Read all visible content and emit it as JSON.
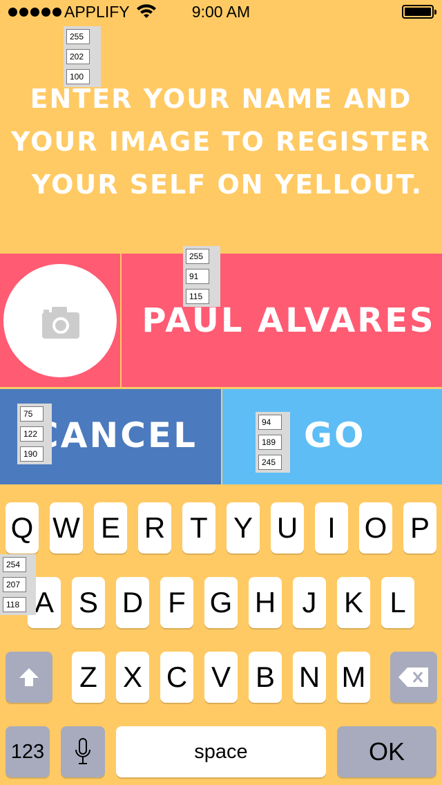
{
  "status_bar": {
    "carrier": "APPLIFY",
    "time": "9:00 AM"
  },
  "headline": {
    "line1": "ENTER YOUR NAME AND",
    "line2": "YOUR IMAGE TO REGISTER",
    "line3": "YOUR SELF ON YELLOUT."
  },
  "registration": {
    "name_value": "PAUL ALVARES"
  },
  "actions": {
    "cancel_label": "CANCEL",
    "go_label": "GO"
  },
  "swatches": {
    "background": {
      "r": "255",
      "g": "202",
      "b": "100",
      "hex": "#ffca64"
    },
    "name_panel": {
      "r": "255",
      "g": "91",
      "b": "115",
      "hex": "#ff5b73"
    },
    "cancel": {
      "r": "75",
      "g": "122",
      "b": "190",
      "hex": "#4b7abe"
    },
    "go": {
      "r": "94",
      "g": "189",
      "b": "245",
      "hex": "#5ebdf5"
    },
    "keyboard": {
      "r": "254",
      "g": "207",
      "b": "118",
      "hex": "#fecf76"
    }
  },
  "keyboard": {
    "row1": [
      "Q",
      "W",
      "E",
      "R",
      "T",
      "Y",
      "U",
      "I",
      "O",
      "P"
    ],
    "row2": [
      "A",
      "S",
      "D",
      "F",
      "G",
      "H",
      "J",
      "K",
      "L"
    ],
    "row3": [
      "Z",
      "X",
      "C",
      "V",
      "B",
      "N",
      "M"
    ],
    "numbers_label": "123",
    "space_label": "space",
    "ok_label": "OK",
    "icons": [
      "shift-icon",
      "backspace-icon",
      "microphone-icon"
    ]
  }
}
